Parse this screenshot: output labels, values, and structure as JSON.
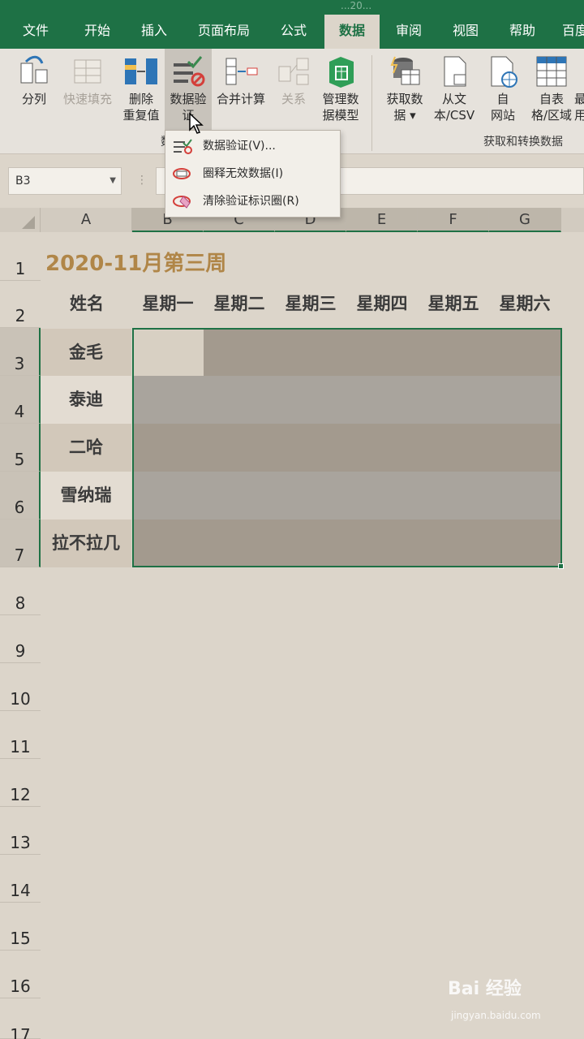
{
  "window": {
    "title": "...20..."
  },
  "tabs": [
    {
      "label": "文件",
      "active": false
    },
    {
      "label": "开始",
      "active": false
    },
    {
      "label": "插入",
      "active": false
    },
    {
      "label": "页面布局",
      "active": false
    },
    {
      "label": "公式",
      "active": false
    },
    {
      "label": "数据",
      "active": true
    },
    {
      "label": "审阅",
      "active": false
    },
    {
      "label": "视图",
      "active": false
    },
    {
      "label": "帮助",
      "active": false
    },
    {
      "label": "百度",
      "active": false
    }
  ],
  "ribbon": {
    "buttons": {
      "split": "分列",
      "flashfill": "快速填充",
      "remove_dup_1": "删除",
      "remove_dup_2": "重复值",
      "validation_1": "数据验",
      "validation_2": "证",
      "consolidate": "合并计算",
      "relations": "关系",
      "model_1": "管理数",
      "model_2": "据模型",
      "getdata_1": "获取数",
      "getdata_2": "据 ▾",
      "fromtext_1": "从文",
      "fromtext_2": "本/CSV",
      "fromweb_1": "自",
      "fromweb_2": "网站",
      "fromtable_1": "自表",
      "fromtable_2": "格/区域",
      "recent_1": "最",
      "recent_2": "用"
    },
    "group_data_tools": "数",
    "group_get_transform": "获取和转换数据"
  },
  "namebox": {
    "value": "B3"
  },
  "formula": {
    "separator": "⋮"
  },
  "dropdown": {
    "items": [
      {
        "label": "数据验证(V)..."
      },
      {
        "label": "圈释无效数据(I)"
      },
      {
        "label": "清除验证标识圈(R)"
      }
    ]
  },
  "columns": [
    "A",
    "B",
    "C",
    "D",
    "E",
    "F",
    "G"
  ],
  "rows": [
    "1",
    "2",
    "3",
    "4",
    "5",
    "6",
    "7",
    "8",
    "9",
    "10",
    "11",
    "12",
    "13",
    "14",
    "15",
    "16",
    "17"
  ],
  "sheet": {
    "title": "2020-11月第三周",
    "header_name": "姓名",
    "weekdays": [
      "星期一",
      "星期二",
      "星期三",
      "星期四",
      "星期五",
      "星期六"
    ],
    "names": [
      "金毛",
      "泰迪",
      "二哈",
      "雪纳瑞",
      "拉不拉几"
    ]
  },
  "colors": {
    "accent": "#1e7145",
    "title": "#b08648"
  },
  "watermark": {
    "main": "Bai 经验",
    "sub": "jingyan.baidu.com"
  }
}
